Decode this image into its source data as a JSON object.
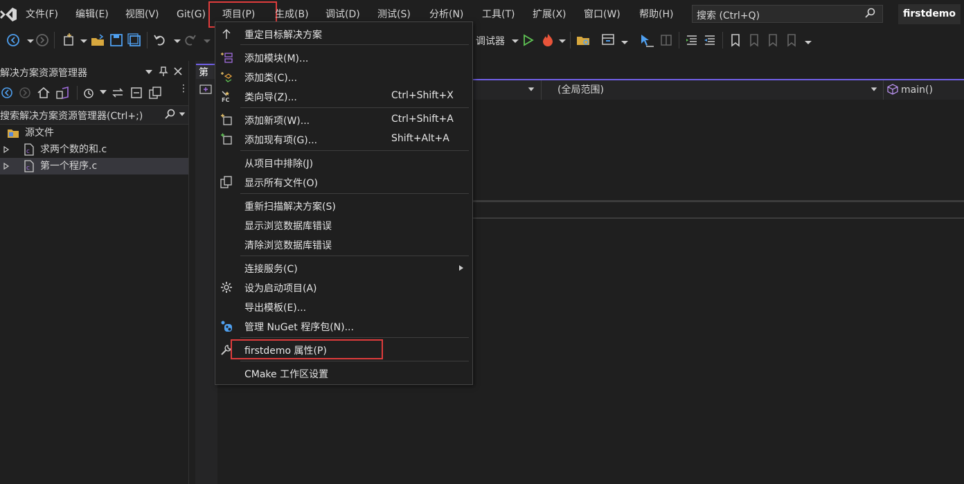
{
  "menubar": {
    "items": [
      {
        "label": "文件(F)"
      },
      {
        "label": "编辑(E)"
      },
      {
        "label": "视图(V)"
      },
      {
        "label": "Git(G)"
      },
      {
        "label": "项目(P)"
      },
      {
        "label": "生成(B)"
      },
      {
        "label": "调试(D)"
      },
      {
        "label": "测试(S)"
      },
      {
        "label": "分析(N)"
      },
      {
        "label": "工具(T)"
      },
      {
        "label": "扩展(X)"
      },
      {
        "label": "窗口(W)"
      },
      {
        "label": "帮助(H)"
      }
    ],
    "search_placeholder": "搜索 (Ctrl+Q)",
    "project_name": "firstdemo"
  },
  "toolbar": {
    "debugger_label": "调试器"
  },
  "solution_explorer": {
    "title": "解决方案资源管理器",
    "search_placeholder": "搜索解决方案资源管理器(Ctrl+;)",
    "tree": [
      {
        "label": "源文件"
      },
      {
        "label": "求两个数的和.c"
      },
      {
        "label": "第一个程序.c"
      }
    ]
  },
  "editor": {
    "tab_label": "第一",
    "scope": "(全局范围)",
    "function": "main()"
  },
  "project_menu": {
    "items": [
      {
        "label": "重定目标解决方案",
        "shortcut": ""
      },
      {
        "label": "添加模块(M)...",
        "shortcut": ""
      },
      {
        "label": "添加类(C)...",
        "shortcut": ""
      },
      {
        "label": "类向导(Z)...",
        "shortcut": "Ctrl+Shift+X"
      },
      {
        "label": "添加新项(W)...",
        "shortcut": "Ctrl+Shift+A"
      },
      {
        "label": "添加现有项(G)...",
        "shortcut": "Shift+Alt+A"
      },
      {
        "label": "从项目中排除(J)",
        "shortcut": ""
      },
      {
        "label": "显示所有文件(O)",
        "shortcut": ""
      },
      {
        "label": "重新扫描解决方案(S)",
        "shortcut": ""
      },
      {
        "label": "显示浏览数据库错误",
        "shortcut": ""
      },
      {
        "label": "清除浏览数据库错误",
        "shortcut": ""
      },
      {
        "label": "连接服务(C)",
        "shortcut": ""
      },
      {
        "label": "设为启动项目(A)",
        "shortcut": ""
      },
      {
        "label": "导出模板(E)...",
        "shortcut": ""
      },
      {
        "label": "管理 NuGet 程序包(N)...",
        "shortcut": ""
      },
      {
        "label": "firstdemo 属性(P)",
        "shortcut": ""
      },
      {
        "label": "CMake 工作区设置",
        "shortcut": ""
      }
    ]
  },
  "colors": {
    "accent": "#7160e8",
    "highlight_box": "#e03c3c",
    "background": "#1f1f1f"
  }
}
